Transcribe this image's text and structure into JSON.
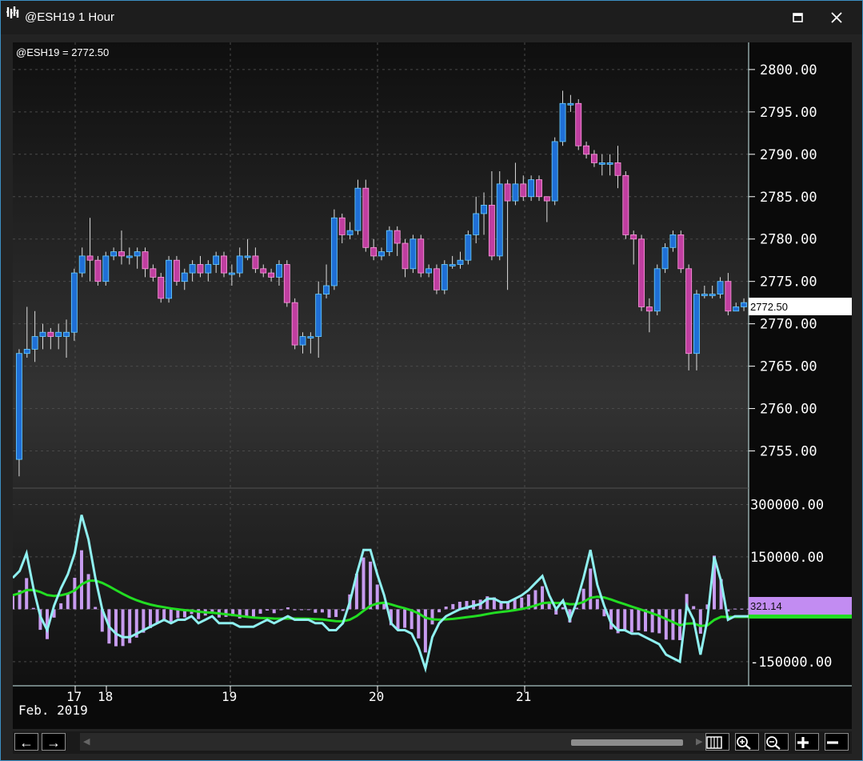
{
  "window": {
    "title": "@ESH19 1 Hour",
    "maximize_icon": "maximize-icon",
    "close_icon": "close-icon"
  },
  "chart_data": {
    "type": "candlestick",
    "symbol_label": "@ESH19 = 2772.50",
    "last_price_label": "2772.50",
    "ylim": [
      2750.8,
      2803.2
    ],
    "price_ticks": [
      "2800.00",
      "2795.00",
      "2790.00",
      "2785.00",
      "2780.00",
      "2775.00",
      "2770.00",
      "2765.00",
      "2760.00",
      "2755.00"
    ],
    "x_labels": [
      "17",
      "18",
      "19",
      "20",
      "21"
    ],
    "x_sublabel": "Feb. 2019",
    "up_color": "#1f6fd6",
    "down_color": "#c03ea0",
    "candles": [
      [
        2754,
        2766.5,
        2752,
        2767
      ],
      [
        2766.5,
        2767,
        2766,
        2772
      ],
      [
        2767,
        2768.5,
        2765.5,
        2771.5
      ],
      [
        2768.5,
        2769,
        2767,
        2770
      ],
      [
        2769,
        2768.5,
        2767,
        2769.5
      ],
      [
        2768.5,
        2769,
        2767,
        2770
      ],
      [
        2768.5,
        2769,
        2766,
        2770.5
      ],
      [
        2769,
        2776,
        2768,
        2776.5
      ],
      [
        2776,
        2778,
        2775.5,
        2779
      ],
      [
        2778,
        2777.5,
        2775,
        2782.5
      ],
      [
        2777.5,
        2775,
        2774.5,
        2778
      ],
      [
        2775,
        2778,
        2774.5,
        2778.5
      ],
      [
        2778,
        2778.5,
        2777.5,
        2779
      ],
      [
        2778.5,
        2778,
        2777,
        2781
      ],
      [
        2778,
        2778,
        2777,
        2779
      ],
      [
        2778,
        2778.5,
        2776.5,
        2779
      ],
      [
        2778.5,
        2776.5,
        2775.5,
        2779
      ],
      [
        2776.5,
        2775.5,
        2775,
        2777
      ],
      [
        2775.5,
        2773,
        2772.5,
        2776
      ],
      [
        2773,
        2777.5,
        2772.5,
        2778
      ],
      [
        2777.5,
        2775,
        2774.5,
        2778
      ],
      [
        2775,
        2776,
        2774,
        2776.5
      ],
      [
        2776,
        2777,
        2775,
        2777.5
      ],
      [
        2777,
        2776,
        2775.5,
        2778
      ],
      [
        2776,
        2777,
        2775,
        2777.5
      ],
      [
        2777,
        2778,
        2776,
        2778.5
      ],
      [
        2778,
        2776,
        2775.5,
        2778.5
      ],
      [
        2776,
        2776,
        2774.5,
        2777
      ],
      [
        2776,
        2778,
        2775.5,
        2779
      ],
      [
        2778,
        2778,
        2777.5,
        2780
      ],
      [
        2778,
        2776.5,
        2776,
        2779
      ],
      [
        2776.5,
        2776,
        2775.5,
        2777
      ],
      [
        2776,
        2775.5,
        2775,
        2776.5
      ],
      [
        2775.5,
        2777,
        2774.5,
        2777.5
      ],
      [
        2777,
        2772.5,
        2772,
        2777.5
      ],
      [
        2772.5,
        2767.5,
        2767,
        2773
      ],
      [
        2767.5,
        2768.5,
        2766.5,
        2769
      ],
      [
        2768.5,
        2768.5,
        2766.5,
        2769
      ],
      [
        2768.5,
        2773.5,
        2766,
        2775
      ],
      [
        2773.5,
        2774.5,
        2773,
        2777
      ],
      [
        2774.5,
        2782.5,
        2774,
        2783.5
      ],
      [
        2782.5,
        2780.5,
        2779.5,
        2783
      ],
      [
        2780.5,
        2781,
        2780,
        2782
      ],
      [
        2781,
        2786,
        2780.5,
        2787
      ],
      [
        2786,
        2779,
        2778.5,
        2787
      ],
      [
        2779,
        2778,
        2777.5,
        2780
      ],
      [
        2778,
        2778.5,
        2777.5,
        2779
      ],
      [
        2778.5,
        2781,
        2778,
        2781.5
      ],
      [
        2781,
        2779.5,
        2778,
        2781.5
      ],
      [
        2779.5,
        2776.5,
        2775.5,
        2780
      ],
      [
        2776.5,
        2780,
        2776,
        2780.5
      ],
      [
        2780,
        2776,
        2775.5,
        2780.5
      ],
      [
        2776,
        2776.5,
        2775.5,
        2777
      ],
      [
        2776.5,
        2774,
        2773.5,
        2777
      ],
      [
        2774,
        2777,
        2773.5,
        2777.5
      ],
      [
        2777,
        2777,
        2776.5,
        2778
      ],
      [
        2777,
        2777.5,
        2776.5,
        2778.5
      ],
      [
        2777.5,
        2780.5,
        2777,
        2781
      ],
      [
        2780.5,
        2783,
        2779.5,
        2785
      ],
      [
        2783,
        2784,
        2780.5,
        2785.5
      ],
      [
        2784,
        2778,
        2777.5,
        2788
      ],
      [
        2778,
        2786.5,
        2777.5,
        2788
      ],
      [
        2786.5,
        2784.5,
        2774,
        2787
      ],
      [
        2784.5,
        2786.5,
        2784,
        2789
      ],
      [
        2786.5,
        2785,
        2784.5,
        2787.5
      ],
      [
        2785,
        2787,
        2784.5,
        2787.5
      ],
      [
        2787,
        2785,
        2784.5,
        2787.5
      ],
      [
        2785,
        2784.5,
        2782,
        2785
      ],
      [
        2784.5,
        2791.5,
        2784,
        2792
      ],
      [
        2791.5,
        2796,
        2791,
        2797.5
      ],
      [
        2796,
        2796,
        2795,
        2797
      ],
      [
        2796,
        2791,
        2790.5,
        2796.5
      ],
      [
        2791,
        2790,
        2789.5,
        2791.5
      ],
      [
        2790,
        2789,
        2788.5,
        2790.5
      ],
      [
        2789,
        2789,
        2787.5,
        2790
      ],
      [
        2789,
        2789,
        2787.5,
        2790
      ],
      [
        2789,
        2787.5,
        2786,
        2791
      ],
      [
        2787.5,
        2780.5,
        2780,
        2788
      ],
      [
        2780.5,
        2780,
        2777,
        2781
      ],
      [
        2780,
        2772,
        2771.5,
        2780.5
      ],
      [
        2772,
        2771.5,
        2769,
        2773
      ],
      [
        2771.5,
        2776.5,
        2771,
        2777
      ],
      [
        2776.5,
        2779,
        2776,
        2779.5
      ],
      [
        2779,
        2780.5,
        2778.5,
        2781
      ],
      [
        2780.5,
        2776.5,
        2776,
        2781
      ],
      [
        2776.5,
        2766.5,
        2764.5,
        2777
      ],
      [
        2766.5,
        2773.5,
        2764.5,
        2774
      ],
      [
        2773.5,
        2773.5,
        2773,
        2774.5
      ],
      [
        2773.5,
        2773.5,
        2773,
        2774.5
      ],
      [
        2773.5,
        2775,
        2773,
        2775.5
      ],
      [
        2775,
        2771.5,
        2771,
        2776
      ],
      [
        2771.5,
        2772,
        2771.5,
        2772.5
      ],
      [
        2772,
        2772.5,
        2771.5,
        2773
      ]
    ],
    "oscillator": {
      "ticks": [
        "300000.00",
        "150000.00",
        "0.00",
        "-150000.00"
      ],
      "ylim": [
        -210000,
        340000
      ],
      "last_value_label": "321.14",
      "histogram_color": "#c79bef",
      "fast_line_color": "#8ff0f0",
      "signal_line_color": "#22dd22",
      "fast": [
        90000,
        110000,
        160000,
        60000,
        -20000,
        -60000,
        10000,
        60000,
        100000,
        160000,
        270000,
        200000,
        90000,
        0,
        -50000,
        -70000,
        -80000,
        -80000,
        -70000,
        -60000,
        -50000,
        -40000,
        -30000,
        -40000,
        -30000,
        -30000,
        -20000,
        -40000,
        -30000,
        -20000,
        -40000,
        -40000,
        -40000,
        -50000,
        -50000,
        -50000,
        -40000,
        -30000,
        -40000,
        -30000,
        -20000,
        -30000,
        -30000,
        -30000,
        -40000,
        -40000,
        -60000,
        -60000,
        -40000,
        20000,
        100000,
        170000,
        170000,
        100000,
        40000,
        -40000,
        -60000,
        -60000,
        -70000,
        -110000,
        -170000,
        -80000,
        -40000,
        -20000,
        -10000,
        0,
        5000,
        10000,
        15000,
        30000,
        30000,
        20000,
        20000,
        30000,
        40000,
        55000,
        75000,
        95000,
        40000,
        0,
        25000,
        -30000,
        20000,
        90000,
        170000,
        70000,
        10000,
        -40000,
        -60000,
        -60000,
        -70000,
        -70000,
        -80000,
        -90000,
        -100000,
        -130000,
        -140000,
        -150000,
        10000,
        -30000,
        -130000,
        -30000,
        150000,
        80000,
        -30000,
        -20000,
        -20000,
        -20000
      ]
    }
  }
}
